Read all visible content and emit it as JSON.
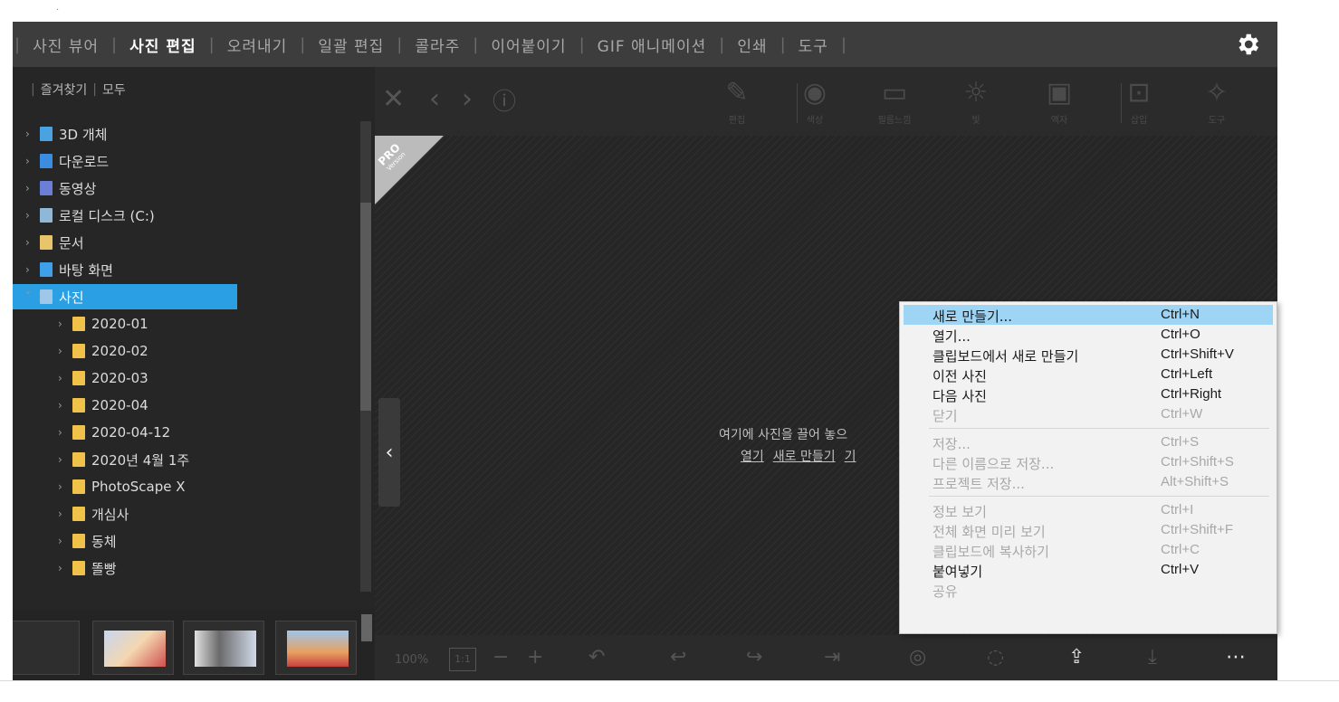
{
  "top_dot": "·",
  "nav": {
    "items": [
      {
        "label": "사진 뷰어",
        "active": false
      },
      {
        "label": "사진 편집",
        "active": true
      },
      {
        "label": "오려내기",
        "active": false
      },
      {
        "label": "일괄 편집",
        "active": false
      },
      {
        "label": "콜라주",
        "active": false
      },
      {
        "label": "이어붙이기",
        "active": false
      },
      {
        "label": "GIF 애니메이션",
        "active": false
      },
      {
        "label": "인쇄",
        "active": false
      },
      {
        "label": "도구",
        "active": false
      }
    ],
    "settings_icon": "gear-icon"
  },
  "favorites": {
    "favorites_label": "즐겨찾기",
    "all_label": "모두"
  },
  "tree": {
    "items": [
      {
        "label": "3D 개체",
        "level": 0,
        "color": "#4aa3e0",
        "selected": false
      },
      {
        "label": "다운로드",
        "level": 0,
        "color": "#3b8de0",
        "selected": false
      },
      {
        "label": "동영상",
        "level": 0,
        "color": "#6b7fd6",
        "selected": false
      },
      {
        "label": "로컬 디스크 (C:)",
        "level": 0,
        "color": "#8fb8d8",
        "selected": false
      },
      {
        "label": "문서",
        "level": 0,
        "color": "#e8c46a",
        "selected": false
      },
      {
        "label": "바탕 화면",
        "level": 0,
        "color": "#3ea0e8",
        "selected": false
      },
      {
        "label": "사진",
        "level": 0,
        "color": "#9ec7e8",
        "selected": true
      },
      {
        "label": "2020-01",
        "level": 1,
        "color": "#f0c24a",
        "selected": false
      },
      {
        "label": "2020-02",
        "level": 1,
        "color": "#f0c24a",
        "selected": false
      },
      {
        "label": "2020-03",
        "level": 1,
        "color": "#f0c24a",
        "selected": false
      },
      {
        "label": "2020-04",
        "level": 1,
        "color": "#f0c24a",
        "selected": false
      },
      {
        "label": "2020-04-12",
        "level": 1,
        "color": "#f0c24a",
        "selected": false
      },
      {
        "label": "2020년 4월 1주",
        "level": 1,
        "color": "#f0c24a",
        "selected": false
      },
      {
        "label": "PhotoScape X",
        "level": 1,
        "color": "#f0c24a",
        "selected": false
      },
      {
        "label": "개심사",
        "level": 1,
        "color": "#f0c24a",
        "selected": false
      },
      {
        "label": "동체",
        "level": 1,
        "color": "#f0c24a",
        "selected": false
      },
      {
        "label": "똘빵",
        "level": 1,
        "color": "#f0c24a",
        "selected": false
      }
    ]
  },
  "viewer": {
    "tools": [
      {
        "label": "편집",
        "glyph": "✎",
        "icon": "edit-icon"
      },
      {
        "label": "색상",
        "glyph": "◉",
        "icon": "color-icon"
      },
      {
        "label": "필름느낌",
        "glyph": "▭",
        "icon": "film-icon"
      },
      {
        "label": "빛",
        "glyph": "☼",
        "icon": "light-icon"
      },
      {
        "label": "액자",
        "glyph": "▣",
        "icon": "frame-icon"
      },
      {
        "label": "삽입",
        "glyph": "⊡",
        "icon": "insert-icon"
      },
      {
        "label": "도구",
        "glyph": "✧",
        "icon": "tools-icon"
      }
    ],
    "pro_badge": {
      "title": "PRO",
      "subtitle": "Version"
    },
    "drop_hint": "여기에 사진을 끌어 놓으",
    "drop_links": [
      "열기",
      "새로 만들기",
      "기"
    ],
    "zoom": {
      "value": "100%",
      "ratio": "1:1"
    }
  },
  "context_menu": {
    "groups": [
      [
        {
          "label": "새로 만들기...",
          "shortcut": "Ctrl+N",
          "enabled": true,
          "highlight": true
        },
        {
          "label": "열기...",
          "shortcut": "Ctrl+O",
          "enabled": true,
          "highlight": false
        },
        {
          "label": "클립보드에서 새로 만들기",
          "shortcut": "Ctrl+Shift+V",
          "enabled": true,
          "highlight": false
        },
        {
          "label": "이전 사진",
          "shortcut": "Ctrl+Left",
          "enabled": true,
          "highlight": false
        },
        {
          "label": "다음 사진",
          "shortcut": "Ctrl+Right",
          "enabled": true,
          "highlight": false
        },
        {
          "label": "닫기",
          "shortcut": "Ctrl+W",
          "enabled": false,
          "highlight": false
        }
      ],
      [
        {
          "label": "저장...",
          "shortcut": "Ctrl+S",
          "enabled": false,
          "highlight": false
        },
        {
          "label": "다른 이름으로 저장...",
          "shortcut": "Ctrl+Shift+S",
          "enabled": false,
          "highlight": false
        },
        {
          "label": "프로젝트 저장...",
          "shortcut": "Alt+Shift+S",
          "enabled": false,
          "highlight": false
        }
      ],
      [
        {
          "label": "정보 보기",
          "shortcut": "Ctrl+I",
          "enabled": false,
          "highlight": false
        },
        {
          "label": "전체 화면 미리 보기",
          "shortcut": "Ctrl+Shift+F",
          "enabled": false,
          "highlight": false
        },
        {
          "label": "클립보드에 복사하기",
          "shortcut": "Ctrl+C",
          "enabled": false,
          "highlight": false
        },
        {
          "label": "붙여넣기",
          "shortcut": "Ctrl+V",
          "enabled": true,
          "highlight": false
        },
        {
          "label": "공유",
          "shortcut": "",
          "enabled": false,
          "highlight": false
        }
      ]
    ]
  },
  "colors": {
    "selected": "#2a9fe3",
    "menu_highlight": "#9ed4f4",
    "background": "#2b2b2b"
  }
}
